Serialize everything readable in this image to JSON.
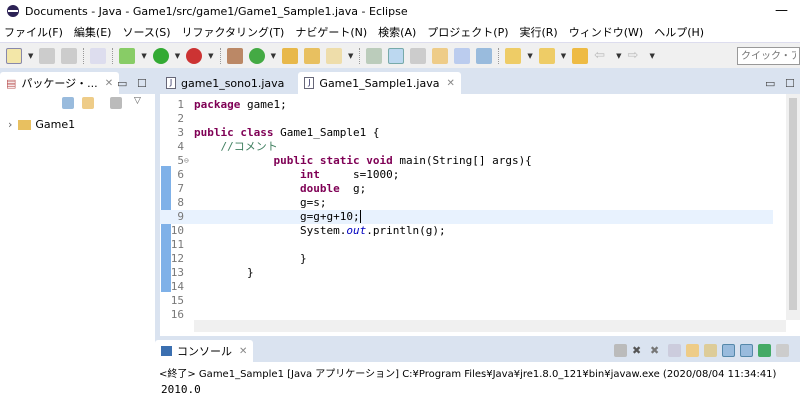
{
  "window": {
    "title": "Documents - Java - Game1/src/game1/Game1_Sample1.java - Eclipse",
    "minimize": "—"
  },
  "menu": [
    "ファイル(F)",
    "編集(E)",
    "ソース(S)",
    "リファクタリング(T)",
    "ナビゲート(N)",
    "検索(A)",
    "プロジェクト(P)",
    "実行(R)",
    "ウィンドウ(W)",
    "ヘルプ(H)"
  ],
  "toolbar": {
    "quick_access_placeholder": "クイック・アクセス"
  },
  "package_explorer": {
    "tab": "パッケージ・...",
    "close": "✕",
    "tree": [
      {
        "label": "Game1",
        "expand": "›"
      }
    ]
  },
  "editor": {
    "tabs": [
      {
        "label": "game1_sono1.java",
        "active": false
      },
      {
        "label": "Game1_Sample1.java",
        "active": true,
        "close": "✕"
      }
    ],
    "lines": [
      {
        "n": "1",
        "seg": [
          {
            "t": "package",
            "c": "k"
          },
          {
            "t": " game1;",
            "c": ""
          }
        ]
      },
      {
        "n": "2",
        "seg": []
      },
      {
        "n": "3",
        "seg": [
          {
            "t": "public",
            "c": "k"
          },
          {
            "t": " ",
            "c": ""
          },
          {
            "t": "class",
            "c": "k"
          },
          {
            "t": " Game1_Sample1 {",
            "c": ""
          }
        ]
      },
      {
        "n": "4",
        "seg": [
          {
            "t": "    //コメント",
            "c": "cm"
          }
        ]
      },
      {
        "n": "5",
        "seg": [
          {
            "t": "            ",
            "c": ""
          },
          {
            "t": "public",
            "c": "k"
          },
          {
            "t": " ",
            "c": ""
          },
          {
            "t": "static",
            "c": "k"
          },
          {
            "t": " ",
            "c": ""
          },
          {
            "t": "void",
            "c": "k"
          },
          {
            "t": " main(String[] args){",
            "c": ""
          }
        ]
      },
      {
        "n": "6",
        "seg": [
          {
            "t": "                ",
            "c": ""
          },
          {
            "t": "int",
            "c": "k"
          },
          {
            "t": "     s=1000;",
            "c": ""
          }
        ]
      },
      {
        "n": "7",
        "seg": [
          {
            "t": "                ",
            "c": ""
          },
          {
            "t": "double",
            "c": "k"
          },
          {
            "t": "  g;",
            "c": ""
          }
        ]
      },
      {
        "n": "8",
        "seg": [
          {
            "t": "                g=s;",
            "c": ""
          }
        ]
      },
      {
        "n": "9",
        "seg": [
          {
            "t": "                g=g+g+10;",
            "c": ""
          }
        ]
      },
      {
        "n": "10",
        "seg": [
          {
            "t": "                System.",
            "c": ""
          },
          {
            "t": "out",
            "c": "st"
          },
          {
            "t": ".println(g);",
            "c": ""
          }
        ]
      },
      {
        "n": "11",
        "seg": []
      },
      {
        "n": "12",
        "seg": [
          {
            "t": "                }",
            "c": ""
          }
        ]
      },
      {
        "n": "13",
        "seg": [
          {
            "t": "        }",
            "c": ""
          }
        ]
      },
      {
        "n": "14",
        "seg": []
      },
      {
        "n": "15",
        "seg": []
      },
      {
        "n": "16",
        "seg": []
      }
    ],
    "current_line": 9
  },
  "console": {
    "tab": "コンソール",
    "close": "✕",
    "header": "<終了> Game1_Sample1 [Java アプリケーション] C:¥Program Files¥Java¥jre1.8.0_121¥bin¥javaw.exe (2020/08/04 11:34:41)",
    "output": "2010.0"
  }
}
